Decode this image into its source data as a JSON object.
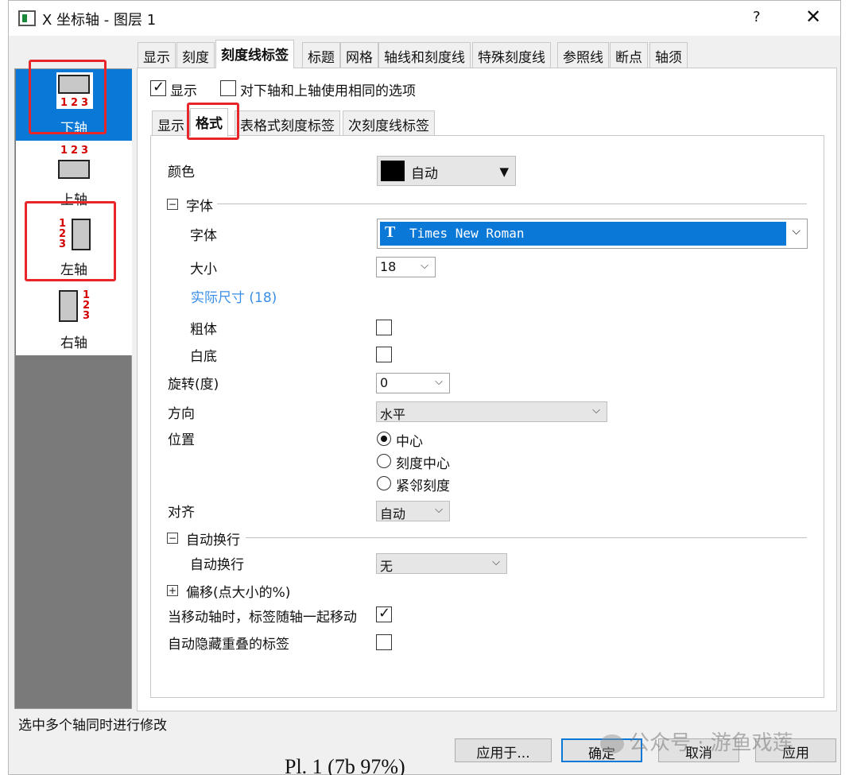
{
  "window": {
    "title": "X 坐标轴 - 图层 1",
    "help_glyph": "?",
    "close_glyph": "✕"
  },
  "axes": {
    "items": [
      {
        "label": "下轴",
        "selected": true
      },
      {
        "label": "上轴",
        "selected": false
      },
      {
        "label": "左轴",
        "selected": false
      },
      {
        "label": "右轴",
        "selected": false
      }
    ],
    "mini_numbers": [
      "1",
      "2",
      "3"
    ]
  },
  "tabs": [
    "显示",
    "刻度",
    "刻度线标签",
    "标题",
    "网格",
    "轴线和刻度线",
    "特殊刻度线",
    "参照线",
    "断点",
    "轴须"
  ],
  "active_tab": "刻度线标签",
  "top_options": {
    "show_label": "显示",
    "same_options_label": "对下轴和上轴使用相同的选项"
  },
  "subtabs": [
    "显示",
    "格式",
    "表格式刻度标签",
    "次刻度线标签"
  ],
  "active_subtab": "格式",
  "form": {
    "color_label": "颜色",
    "color_value": "自动",
    "color_swatch": "#000000",
    "font_section": "字体",
    "font_label": "字体",
    "font_value": "Times New Roman",
    "font_icon": "T",
    "size_label": "大小",
    "size_value": "18",
    "actual_size_label": "实际尺寸 (18)",
    "bold_label": "粗体",
    "white_bg_label": "白底",
    "rotation_label": "旋转(度)",
    "rotation_value": "0",
    "direction_label": "方向",
    "direction_value": "水平",
    "position_label": "位置",
    "position_options": [
      "中心",
      "刻度中心",
      "紧邻刻度"
    ],
    "align_label": "对齐",
    "align_value": "自动",
    "wrap_section": "自动换行",
    "wrap_label": "自动换行",
    "wrap_value": "无",
    "offset_section": "偏移(点大小的%)",
    "move_with_axis_label": "当移动轴时，标签随轴一起移动",
    "auto_hide_label": "自动隐藏重叠的标签"
  },
  "status_text": "选中多个轴同时进行修改",
  "buttons": {
    "apply_to": "应用于...",
    "ok": "确定",
    "cancel": "取消",
    "apply": "应用"
  },
  "watermark": "公众号 · 游鱼戏莲",
  "background_fragment": "Pl. 1 (7b 97%)",
  "accent_color": "#0a78d7",
  "highlight_color": "#e8262a"
}
